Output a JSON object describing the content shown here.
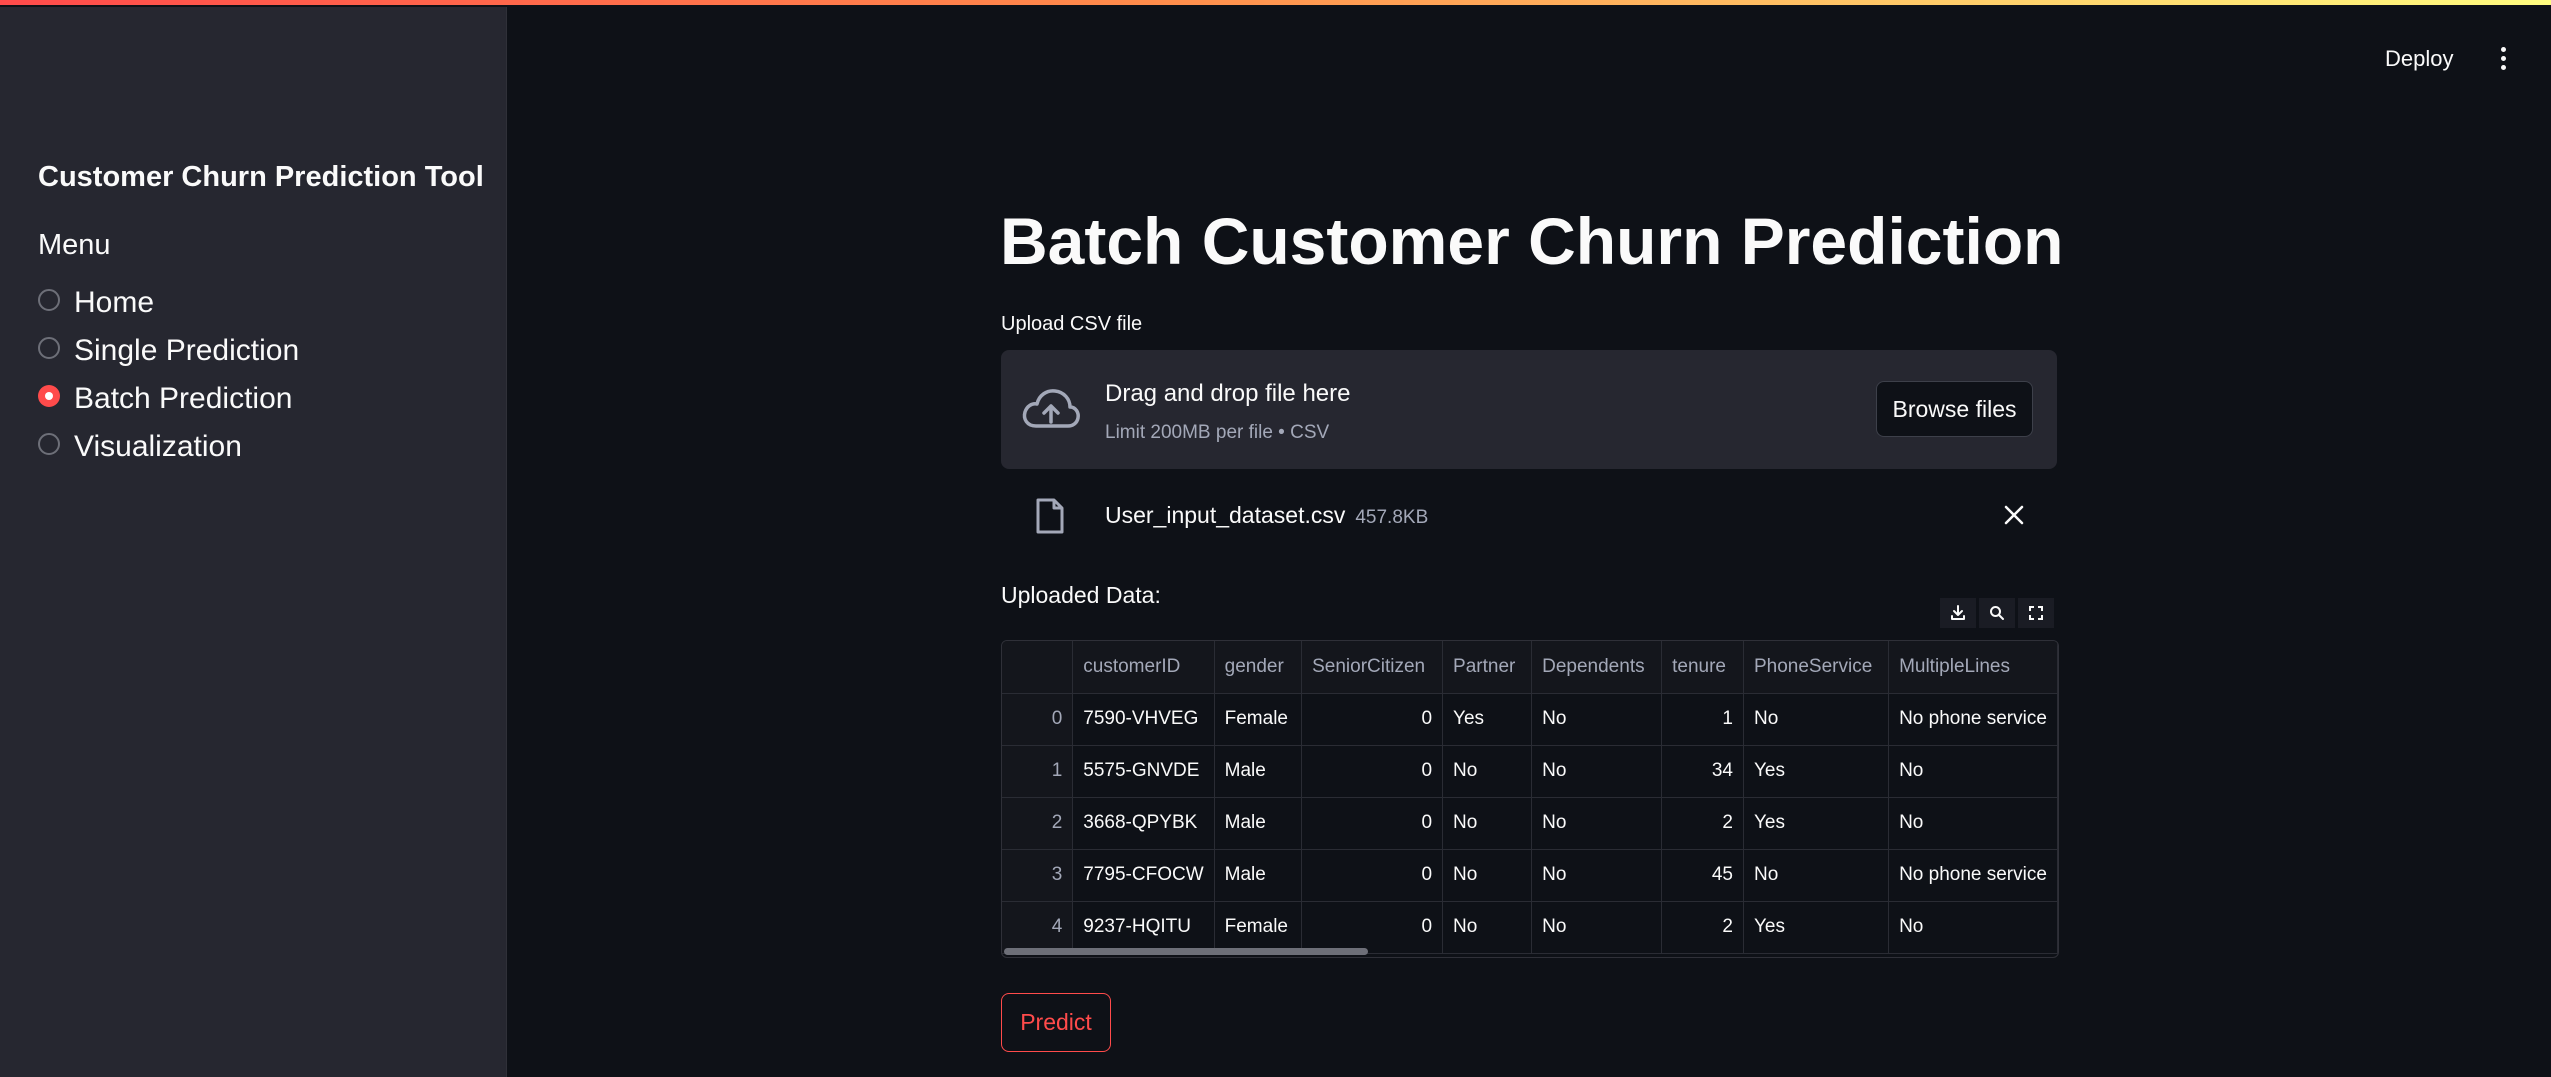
{
  "sidebar": {
    "title": "Customer Churn Prediction Tool",
    "menu_label": "Menu",
    "items": [
      {
        "label": "Home",
        "selected": false
      },
      {
        "label": "Single Prediction",
        "selected": false
      },
      {
        "label": "Batch Prediction",
        "selected": true
      },
      {
        "label": "Visualization",
        "selected": false
      }
    ]
  },
  "header": {
    "deploy_label": "Deploy",
    "menu_icon": "kebab-menu-icon"
  },
  "main": {
    "title": "Batch Customer Churn Prediction",
    "upload": {
      "label": "Upload CSV file",
      "drop_title": "Drag and drop file here",
      "drop_sub": "Limit 200MB per file • CSV",
      "browse_label": "Browse files"
    },
    "file": {
      "name": "User_input_dataset.csv",
      "size": "457.8KB"
    },
    "uploaded_label": "Uploaded Data:",
    "table": {
      "columns": [
        "",
        "customerID",
        "gender",
        "SeniorCitizen",
        "Partner",
        "Dependents",
        "tenure",
        "PhoneService",
        "MultipleLines"
      ],
      "rows": [
        [
          "0",
          "7590-VHVEG",
          "Female",
          "0",
          "Yes",
          "No",
          "1",
          "No",
          "No phone service"
        ],
        [
          "1",
          "5575-GNVDE",
          "Male",
          "0",
          "No",
          "No",
          "34",
          "Yes",
          "No"
        ],
        [
          "2",
          "3668-QPYBK",
          "Male",
          "0",
          "No",
          "No",
          "2",
          "Yes",
          "No"
        ],
        [
          "3",
          "7795-CFOCW",
          "Male",
          "0",
          "No",
          "No",
          "45",
          "No",
          "No phone service"
        ],
        [
          "4",
          "9237-HQITU",
          "Female",
          "0",
          "No",
          "No",
          "2",
          "Yes",
          "No"
        ]
      ]
    },
    "predict_label": "Predict"
  },
  "colors": {
    "accent": "#ff4b4b",
    "background": "#0e1117",
    "sidebar": "#262730"
  }
}
